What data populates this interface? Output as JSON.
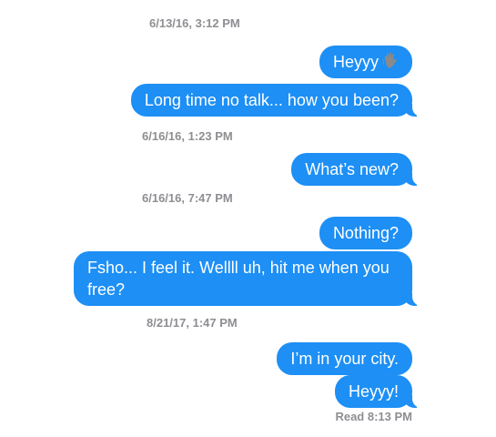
{
  "messages": {
    "timestamps": [
      "6/13/16, 3:12 PM",
      "6/16/16, 1:23 PM",
      "6/16/16, 7:47 PM",
      "8/21/17, 1:47 PM"
    ],
    "bubbles": [
      "Heyyy",
      "Long time no talk... how you been?",
      "What’s new?",
      "Nothing?",
      "Fsho... I feel it. Wellll uh, hit me when you free?",
      "I’m in your city.",
      "Heyyy!"
    ],
    "bubble_icons": {
      "0": "waving-hand-icon"
    },
    "read_receipt": "Read 8:13 PM"
  },
  "colors": {
    "bubble": "#1d8ff5",
    "bubble_text": "#ffffff",
    "timestamp": "#8e8e93",
    "background": "#ffffff"
  }
}
